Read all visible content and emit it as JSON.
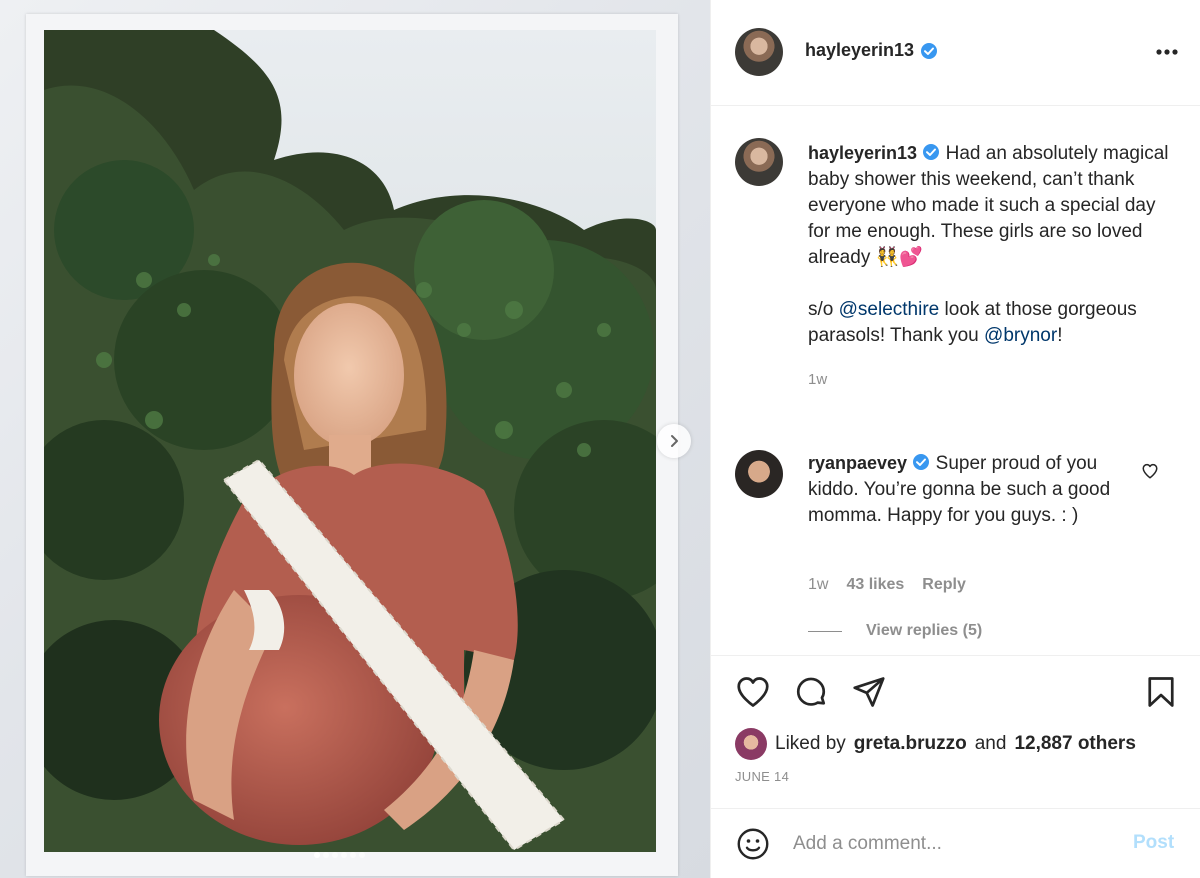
{
  "header": {
    "username": "hayleyerin13",
    "verified_icon": "verified-badge-icon",
    "more_icon": "ellipsis-icon"
  },
  "caption": {
    "username": "hayleyerin13",
    "text_line1": "Had an absolutely magical baby shower this weekend, can’t thank everyone who made it such a special day for me enough. These girls are so loved already",
    "emoji": "👯💕",
    "shoutout_prefix": "s/o",
    "mention1": "@selecthire",
    "shoutout_middle": "look at those gorgeous parasols! Thank you",
    "mention2": "@brynor",
    "shoutout_suffix": "!",
    "time": "1w"
  },
  "comment": {
    "username": "ryanpaevey",
    "text": "Super proud of you kiddo. You’re gonna be such a good momma. Happy for you guys. : )",
    "time": "1w",
    "likes": "43 likes",
    "reply_label": "Reply",
    "view_replies": "View replies (5)"
  },
  "actions": {
    "liked_by_prefix": "Liked by",
    "liked_by_user": "greta.bruzzo",
    "liked_by_mid": "and",
    "liked_by_others": "12,887 others",
    "date": "JUNE 14"
  },
  "comment_box": {
    "placeholder": "Add a comment...",
    "post_label": "Post"
  },
  "carousel": {
    "slide_count": 6,
    "active_index": 0
  },
  "colors": {
    "verified": "#3897f0",
    "mention": "#00376b",
    "muted": "#8e8e8e",
    "post_disabled": "#b2dffc"
  }
}
